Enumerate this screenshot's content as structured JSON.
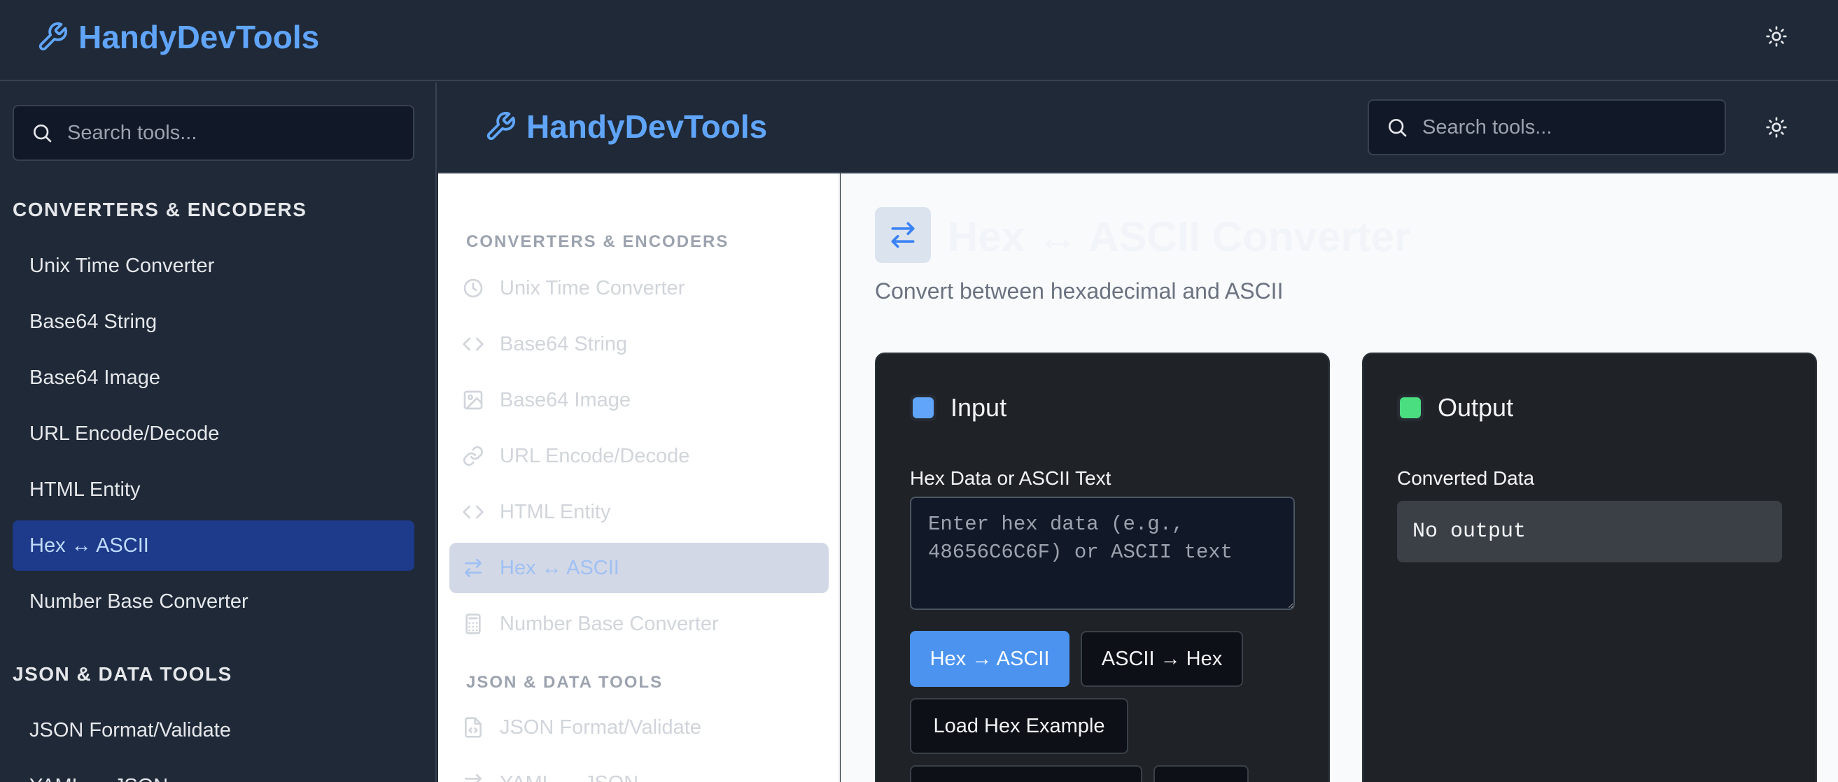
{
  "app": {
    "brand": "HandyDevTools"
  },
  "outer_sidebar": {
    "search_placeholder": "Search tools...",
    "sections": [
      {
        "title": "CONVERTERS & ENCODERS"
      },
      {
        "title": "JSON & DATA TOOLS"
      }
    ],
    "items": [
      {
        "label": "Unix Time Converter"
      },
      {
        "label": "Base64 String"
      },
      {
        "label": "Base64 Image"
      },
      {
        "label": "URL Encode/Decode"
      },
      {
        "label": "HTML Entity"
      },
      {
        "label": "Hex ↔ ASCII"
      },
      {
        "label": "Number Base Converter"
      },
      {
        "label": "JSON Format/Validate"
      },
      {
        "label": "YAML ↔ JSON"
      }
    ]
  },
  "inner_header": {
    "brand": "HandyDevTools",
    "search_placeholder": "Search tools..."
  },
  "inner_sidebar": {
    "sections": [
      {
        "title": "CONVERTERS & ENCODERS"
      },
      {
        "title": "JSON & DATA TOOLS"
      }
    ],
    "items": [
      {
        "label": "Unix Time Converter",
        "icon": "clock-icon"
      },
      {
        "label": "Base64 String",
        "icon": "code-icon"
      },
      {
        "label": "Base64 Image",
        "icon": "image-icon"
      },
      {
        "label": "URL Encode/Decode",
        "icon": "link-icon"
      },
      {
        "label": "HTML Entity",
        "icon": "code-icon"
      },
      {
        "label": "Hex ↔ ASCII",
        "icon": "arrows-swap-icon"
      },
      {
        "label": "Number Base Converter",
        "icon": "calculator-icon"
      },
      {
        "label": "JSON Format/Validate",
        "icon": "file-code-icon"
      },
      {
        "label": "YAML ↔ JSON",
        "icon": "arrows-swap-icon"
      }
    ]
  },
  "tool": {
    "title": "Hex ↔ ASCII Converter",
    "subtitle": "Convert between hexadecimal and ASCII",
    "input": {
      "title": "Input",
      "field_label": "Hex Data or ASCII Text",
      "placeholder": "Enter hex data (e.g., 48656C6C6F) or ASCII text",
      "value": "",
      "buttons": {
        "hex_to_ascii": "Hex → ASCII",
        "ascii_to_hex": "ASCII → Hex",
        "load_example": "Load Hex Example"
      }
    },
    "output": {
      "title": "Output",
      "field_label": "Converted Data",
      "value": "No output"
    }
  },
  "colors": {
    "accent": "#60a5fa",
    "input_dot": "#60a5fa",
    "output_dot": "#4ade80",
    "active_bg": "#1e3a8a"
  }
}
